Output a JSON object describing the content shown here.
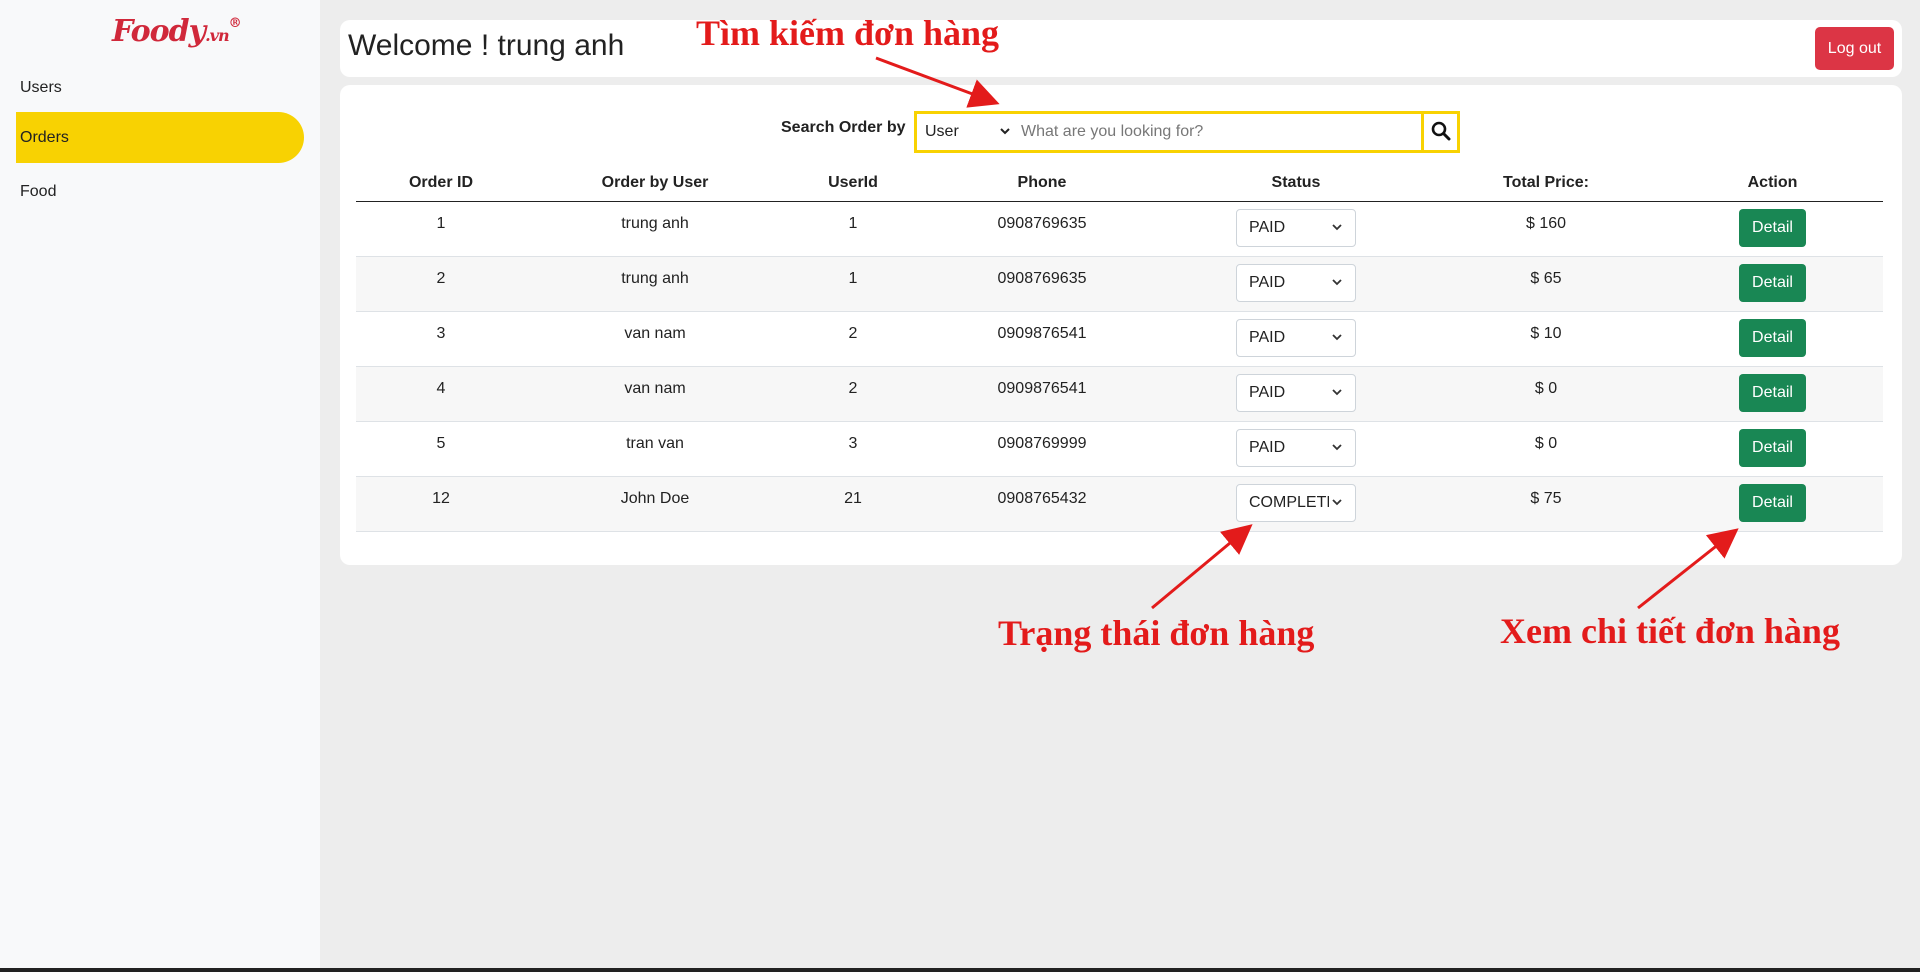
{
  "sidebar": {
    "logo_main": "Foody",
    "logo_suffix": ".vn",
    "logo_reg": "®",
    "items": [
      {
        "label": "Users"
      },
      {
        "label": "Orders",
        "active": true
      },
      {
        "label": "Food"
      }
    ]
  },
  "header": {
    "welcome": "Welcome ! trung anh",
    "logout_label": "Log out"
  },
  "search": {
    "label": "Search Order by",
    "field_value": "User",
    "placeholder": "What are you looking for?"
  },
  "table": {
    "columns": [
      "Order ID",
      "Order by User",
      "UserId",
      "Phone",
      "Status",
      "Total Price:",
      "Action"
    ],
    "rows": [
      {
        "id": "1",
        "user": "trung anh",
        "userid": "1",
        "phone": "0908769635",
        "status": "PAID",
        "total": "$ 160",
        "action": "Detail"
      },
      {
        "id": "2",
        "user": "trung anh",
        "userid": "1",
        "phone": "0908769635",
        "status": "PAID",
        "total": "$ 65",
        "action": "Detail"
      },
      {
        "id": "3",
        "user": "van nam",
        "userid": "2",
        "phone": "0909876541",
        "status": "PAID",
        "total": "$ 10",
        "action": "Detail"
      },
      {
        "id": "4",
        "user": "van nam",
        "userid": "2",
        "phone": "0909876541",
        "status": "PAID",
        "total": "$ 0",
        "action": "Detail"
      },
      {
        "id": "5",
        "user": "tran van",
        "userid": "3",
        "phone": "0908769999",
        "status": "PAID",
        "total": "$ 0",
        "action": "Detail"
      },
      {
        "id": "12",
        "user": "John Doe",
        "userid": "21",
        "phone": "0908765432",
        "status": "COMPLETED",
        "total": "$ 75",
        "action": "Detail"
      }
    ]
  },
  "annotations": {
    "search": "Tìm kiếm đơn hàng",
    "status": "Trạng thái đơn hàng",
    "detail": "Xem chi tiết đơn hàng"
  },
  "colors": {
    "accent_yellow": "#f8d202",
    "logout_red": "#dc3545",
    "detail_green": "#198754",
    "annotation_red": "#e31b1b"
  },
  "icons": {
    "search_button": "search-icon",
    "select_chevron": "chevron-down-icon"
  }
}
